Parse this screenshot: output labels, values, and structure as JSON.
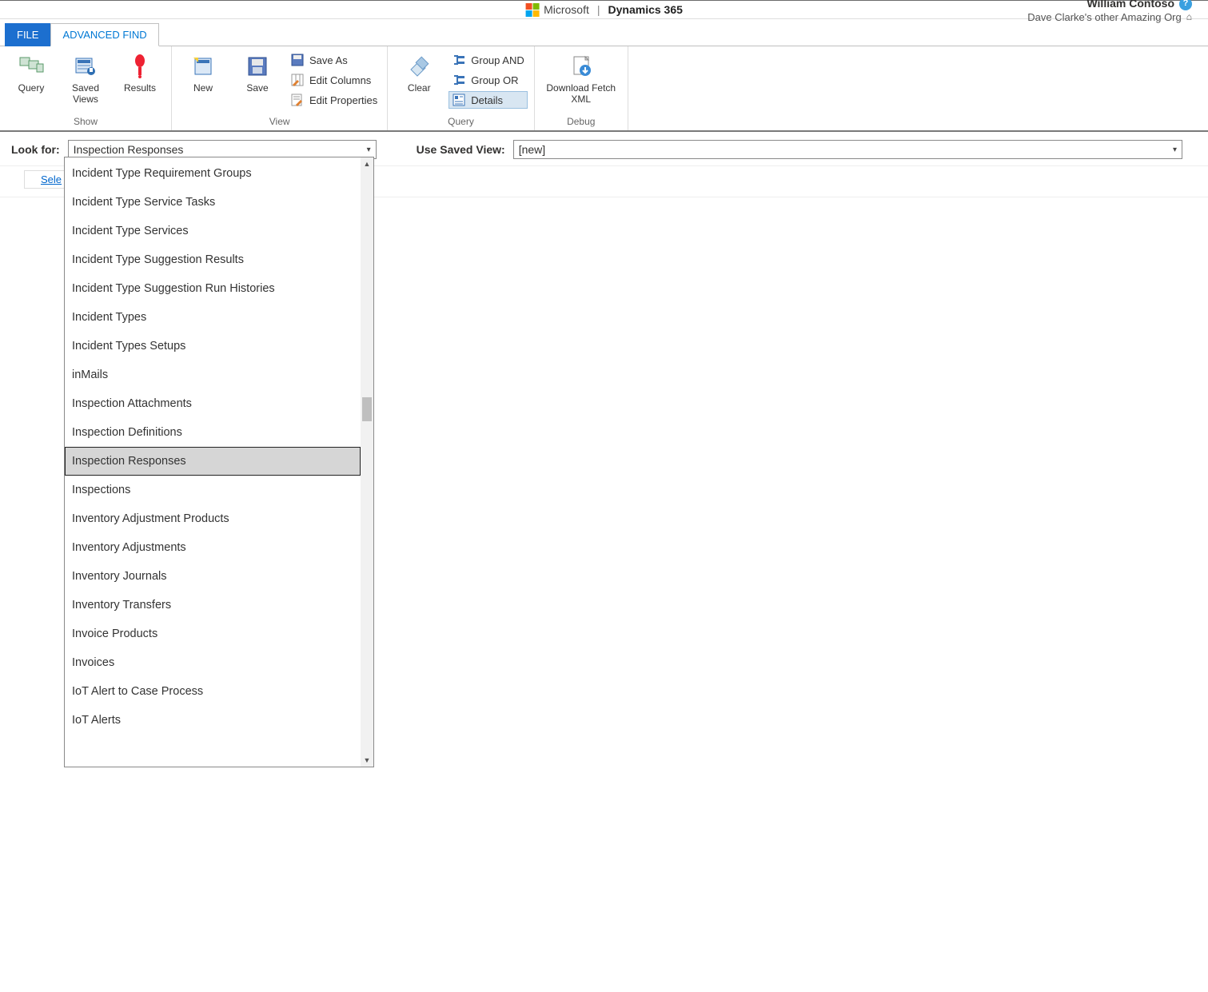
{
  "brand": {
    "ms": "Microsoft",
    "product": "Dynamics 365"
  },
  "user": {
    "name": "William Contoso",
    "org": "Dave Clarke's other Amazing Org"
  },
  "tabs": {
    "file": "FILE",
    "advanced_find": "ADVANCED FIND"
  },
  "ribbon": {
    "show": {
      "label": "Show",
      "query": "Query",
      "saved_views": "Saved\nViews",
      "results": "Results"
    },
    "view": {
      "label": "View",
      "new": "New",
      "save": "Save",
      "save_as": "Save As",
      "edit_columns": "Edit Columns",
      "edit_properties": "Edit Properties"
    },
    "query": {
      "label": "Query",
      "clear": "Clear",
      "group_and": "Group AND",
      "group_or": "Group OR",
      "details": "Details"
    },
    "debug": {
      "label": "Debug",
      "download_fetch_xml": "Download Fetch\nXML"
    }
  },
  "criteria": {
    "look_for_label": "Look for:",
    "look_for_value": "Inspection Responses",
    "saved_view_label": "Use Saved View:",
    "saved_view_value": "[new]"
  },
  "select_link": "Sele",
  "dropdown": {
    "selected_index": 10,
    "items": [
      "Incident Type Requirement Groups",
      "Incident Type Service Tasks",
      "Incident Type Services",
      "Incident Type Suggestion Results",
      "Incident Type Suggestion Run Histories",
      "Incident Types",
      "Incident Types Setups",
      "inMails",
      "Inspection Attachments",
      "Inspection Definitions",
      "Inspection Responses",
      "Inspections",
      "Inventory Adjustment Products",
      "Inventory Adjustments",
      "Inventory Journals",
      "Inventory Transfers",
      "Invoice Products",
      "Invoices",
      "IoT Alert to Case Process",
      "IoT Alerts"
    ]
  }
}
